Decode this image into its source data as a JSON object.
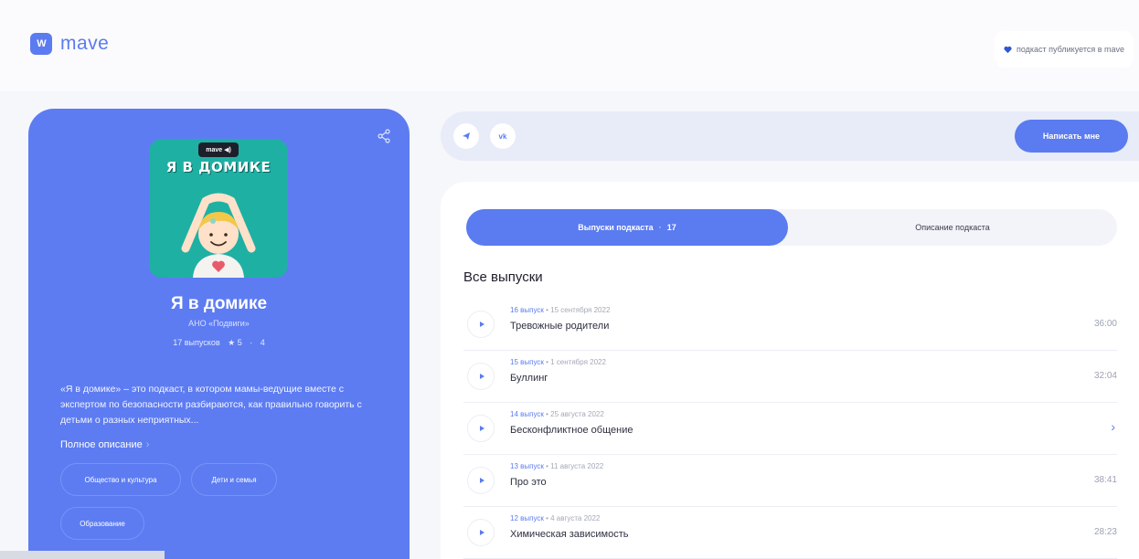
{
  "header": {
    "logo_mark": "W",
    "logo_text": "mave",
    "publish_note": "подкаст публикуется в mave"
  },
  "podcast": {
    "cover_badge": "mave ◀)",
    "cover_title": "Я В ДОМИКЕ",
    "title": "Я в домике",
    "author": "АНО «Подвиги»",
    "episodes_count": "17 выпусков",
    "rating": "★ 5",
    "rating_dot": "·",
    "rating_count": "4",
    "description": "«Я в домике» – это подкаст, в котором мамы-ведущие вместе с экспертом по безопасности разбираются, как правильно говорить с детьми о разных неприятных...",
    "full_description_link": "Полное описание",
    "tags": [
      "Общество и культура",
      "Дети и семья",
      "Образование"
    ]
  },
  "social": {
    "telegram_label": "tg",
    "vk_label": "vk",
    "write_button": "Написать мне"
  },
  "tabs": {
    "episodes_label": "Выпуски подкаста",
    "episodes_dot": "·",
    "episodes_count": "17",
    "description_label": "Описание подкаста"
  },
  "episodes_section_title": "Все выпуски",
  "episodes": [
    {
      "number": "16 выпуск",
      "date": "15 сентября 2022",
      "title": "Тревожные родители",
      "duration": "36:00"
    },
    {
      "number": "15 выпуск",
      "date": "1 сентября 2022",
      "title": "Буллинг",
      "duration": "32:04"
    },
    {
      "number": "14 выпуск",
      "date": "25 августа 2022",
      "title": "Бесконфликтное общение",
      "duration": "›"
    },
    {
      "number": "13 выпуск",
      "date": "11 августа 2022",
      "title": "Про это",
      "duration": "38:41"
    },
    {
      "number": "12 выпуск",
      "date": "4 августа 2022",
      "title": "Химическая зависимость",
      "duration": "28:23"
    }
  ],
  "colors": {
    "accent": "#5b7bf0",
    "card": "#5d7cf2",
    "cover": "#1fb0a4"
  }
}
